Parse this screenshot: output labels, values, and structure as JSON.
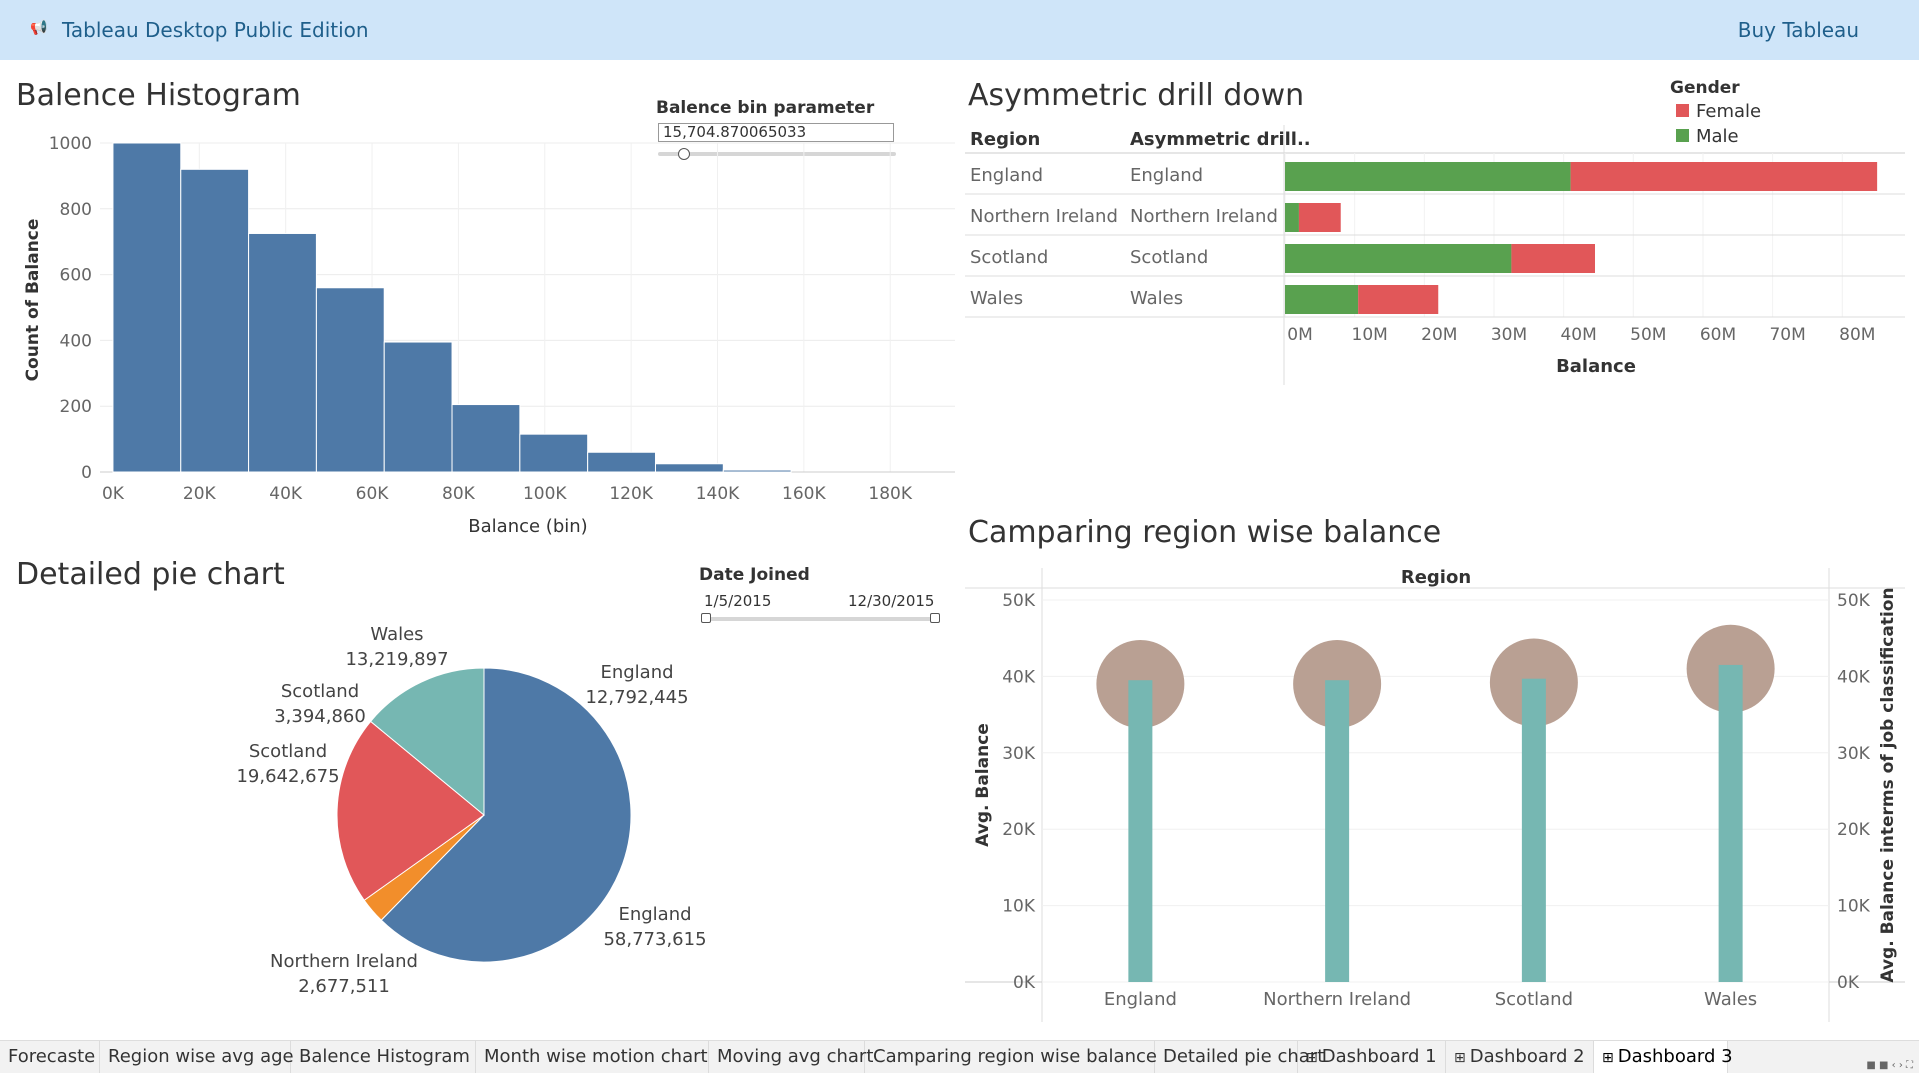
{
  "topbar": {
    "app_title": "Tableau Desktop Public Edition",
    "buy_label": "Buy Tableau",
    "app_icon": "megaphone-icon"
  },
  "histogram": {
    "title": "Balence Histogram",
    "parameter_label": "Balence bin parameter",
    "parameter_value": "15,704.870065033",
    "chart_data": {
      "type": "bar",
      "xlabel": "Balance (bin)",
      "ylabel": "Count of Balance",
      "x_ticks": [
        "0K",
        "20K",
        "40K",
        "60K",
        "80K",
        "100K",
        "120K",
        "140K",
        "160K",
        "180K"
      ],
      "y_ticks": [
        "1000",
        "800",
        "600",
        "400",
        "200",
        "0"
      ],
      "ylim": [
        0,
        1000
      ],
      "xlim": [
        -3000,
        195000
      ],
      "bin_width": 15704.87,
      "values": [
        1000,
        920,
        725,
        560,
        395,
        205,
        115,
        60,
        25,
        6,
        0,
        0
      ],
      "color": "#4e79a7"
    }
  },
  "drilldown": {
    "title": "Asymmetric drill down",
    "legend_title": "Gender",
    "col_region": "Region",
    "col_drill": "Asymmetric drill..",
    "rows": [
      {
        "region": "England",
        "drill": "England"
      },
      {
        "region": "Northern Ireland",
        "drill": "Northern Ireland"
      },
      {
        "region": "Scotland",
        "drill": "Scotland"
      },
      {
        "region": "Wales",
        "drill": "Wales"
      }
    ],
    "chart_data": {
      "type": "bar",
      "orientation": "horizontal-stacked",
      "categories": [
        "England",
        "Northern Ireland",
        "Scotland",
        "Wales"
      ],
      "series": [
        {
          "name": "Male",
          "values": [
            41,
            2,
            32.5,
            10.5
          ],
          "color": "#59a14f"
        },
        {
          "name": "Female",
          "values": [
            44,
            6,
            12,
            11.5
          ],
          "color": "#e15759"
        }
      ],
      "xlabel": "Balance",
      "x_ticks": [
        "0M",
        "10M",
        "20M",
        "30M",
        "40M",
        "50M",
        "60M",
        "70M",
        "80M"
      ],
      "xlim": [
        0,
        89
      ]
    }
  },
  "pie": {
    "title": "Detailed pie chart",
    "date_label": "Date Joined",
    "date_start": "1/5/2015",
    "date_end": "12/30/2015",
    "chart_data": {
      "type": "pie",
      "slices": [
        {
          "label": "England",
          "value": 58773615,
          "value_text": "58,773,615",
          "color": "#4e79a7"
        },
        {
          "label": "Northern Ireland",
          "value": 2677511,
          "value_text": "2,677,511",
          "color": "#f28e2b"
        },
        {
          "label": "Scotland",
          "value": 19642675,
          "value_text": "19,642,675",
          "color": "#e15759"
        },
        {
          "label": "Wales",
          "value": 13219897,
          "value_text": "13,219,897",
          "color": "#76b7b2"
        }
      ],
      "extra_labels": [
        {
          "label": "Scotland",
          "value_text": "3,394,860"
        },
        {
          "label": "England",
          "value_text": "12,792,445"
        }
      ]
    }
  },
  "lollipop": {
    "title": "Camparing region wise balance",
    "header": "Region",
    "chart_data": {
      "type": "bar",
      "categories": [
        "England",
        "Northern Ireland",
        "Scotland",
        "Wales"
      ],
      "series": [
        {
          "name": "Avg. Balance",
          "values": [
            39500,
            39500,
            39700,
            41500
          ],
          "color": "#76b7b2"
        },
        {
          "name": "Avg. Balance interms of job classification",
          "values": [
            39000,
            39000,
            39200,
            41000
          ],
          "color": "#b9a093"
        }
      ],
      "ylabel_left": "Avg. Balance",
      "ylabel_right": "Avg. Balance interms of job classification",
      "y_ticks": [
        "50K",
        "40K",
        "30K",
        "20K",
        "10K",
        "0K"
      ],
      "ylim": [
        0,
        50000
      ]
    }
  },
  "tabs": [
    {
      "label": "Forecaste",
      "icon": ""
    },
    {
      "label": "Region wise avg age",
      "icon": ""
    },
    {
      "label": "Balence Histogram",
      "icon": ""
    },
    {
      "label": "Month wise motion chart",
      "icon": ""
    },
    {
      "label": "Moving avg chart",
      "icon": ""
    },
    {
      "label": "Camparing region wise balance",
      "icon": ""
    },
    {
      "label": "Detailed pie chart",
      "icon": ""
    },
    {
      "label": "Dashboard 1",
      "icon": "⊞"
    },
    {
      "label": "Dashboard 2",
      "icon": "⊞"
    },
    {
      "label": "Dashboard 3",
      "icon": "⊞",
      "active": true
    }
  ]
}
